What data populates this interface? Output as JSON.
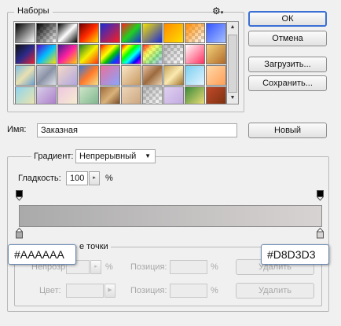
{
  "presets": {
    "title": "Наборы",
    "gear_icon": "gear-icon",
    "swatches": [
      "linear-gradient(135deg,#000,#fff)",
      "checker-black",
      "linear-gradient(135deg,#000,#fff,#000)",
      "linear-gradient(135deg,#6a0000,#ff2a00,#ffe000)",
      "linear-gradient(135deg,#1a2bd8,#ff1d1d)",
      "linear-gradient(135deg,#ff2020,#20d020,#1c2ae0)",
      "linear-gradient(135deg,#f5e100,#1a2bd8)",
      "linear-gradient(135deg,#ff8a00,#ffe000)",
      "checker-orange",
      "linear-gradient(135deg,#3456ff,#a6c0ff)",
      "linear-gradient(135deg,#111,#2a2a8a,#e23)",
      "linear-gradient(135deg,#5a00c8,#00c0ff,#ffe000)",
      "linear-gradient(135deg,#3a1d8f,#ff20a0,#ffd000)",
      "linear-gradient(135deg,#1e7a2a,#f5f000,#ff3010)",
      "linear-gradient(135deg,#ff0000,#ffa000,#ffff00,#00c000,#0040ff,#8000ff)",
      "linear-gradient(135deg,#ff0000,#ffff00,#00ff00,#00ffff,#0000ff,#ff00ff)",
      "checker-rainbow",
      "checker-gray",
      "linear-gradient(135deg,#ffffff,#ff3060)",
      "linear-gradient(135deg,#f3d37a,#b26a2a)",
      "linear-gradient(135deg,#7fbfe6,#e8e0b0,#6aa0d0)",
      "linear-gradient(135deg,#c8ccd6,#8a92a6,#dfe3ea)",
      "linear-gradient(135deg,#f4d9c6,#b0a6e0)",
      "linear-gradient(135deg,#3a7cd8,#ff7a2a,#f4e08a)",
      "linear-gradient(135deg,#ea6f98,#8aa4ff)",
      "linear-gradient(135deg,#f8e6c8,#c79860)",
      "linear-gradient(135deg,#e9c0a0,#9c6a3e,#e8d2b0)",
      "linear-gradient(135deg,#c6a45a,#fbe9b0,#a2752e)",
      "linear-gradient(135deg,#7acef0,#e3f4ff)",
      "linear-gradient(135deg,#ffd9a8,#ff9e57)",
      "linear-gradient(135deg,#8fd4ef,#f2e6a8)",
      "linear-gradient(135deg,#d8cfe7,#a97ac9)",
      "linear-gradient(135deg,#eec6e0,#f7f0d0)",
      "linear-gradient(135deg,#cfe5c6,#7ab48c)",
      "linear-gradient(135deg,#9e6b3a,#d9b27a,#6c3f1d)",
      "linear-gradient(135deg,#eed6b8,#c9a37c)",
      "checker-gray",
      "linear-gradient(135deg,#e0d0f0,#c0a8e0)",
      "linear-gradient(135deg,#3a8a3a,#f7e27a)",
      "linear-gradient(135deg,#c04a2a,#7a3010)"
    ]
  },
  "buttons": {
    "ok": "ОК",
    "cancel": "Отмена",
    "load": "Загрузить...",
    "save": "Сохранить...",
    "new": "Новый",
    "delete_opacity": "Удалить",
    "delete_color": "Удалить"
  },
  "name": {
    "label": "Имя:",
    "value": "Заказная"
  },
  "gradient": {
    "type_label": "Градиент:",
    "type_value": "Непрерывный",
    "smoothness_label": "Гладкость:",
    "smoothness_value": "100",
    "smoothness_unit": "%",
    "left_color": "#AAAAAA",
    "right_color": "#D8D3D3"
  },
  "stops": {
    "group_title_fragment": "е точки",
    "opacity_label_fragment": "Непрозр.",
    "opacity_unit": "%",
    "position_label": "Позиция:",
    "position_unit": "%",
    "color_label": "Цвет:",
    "color_position_label": "Позиция:",
    "color_position_unit": "%"
  },
  "callouts": {
    "left": "#AAAAAA",
    "right": "#D8D3D3"
  }
}
